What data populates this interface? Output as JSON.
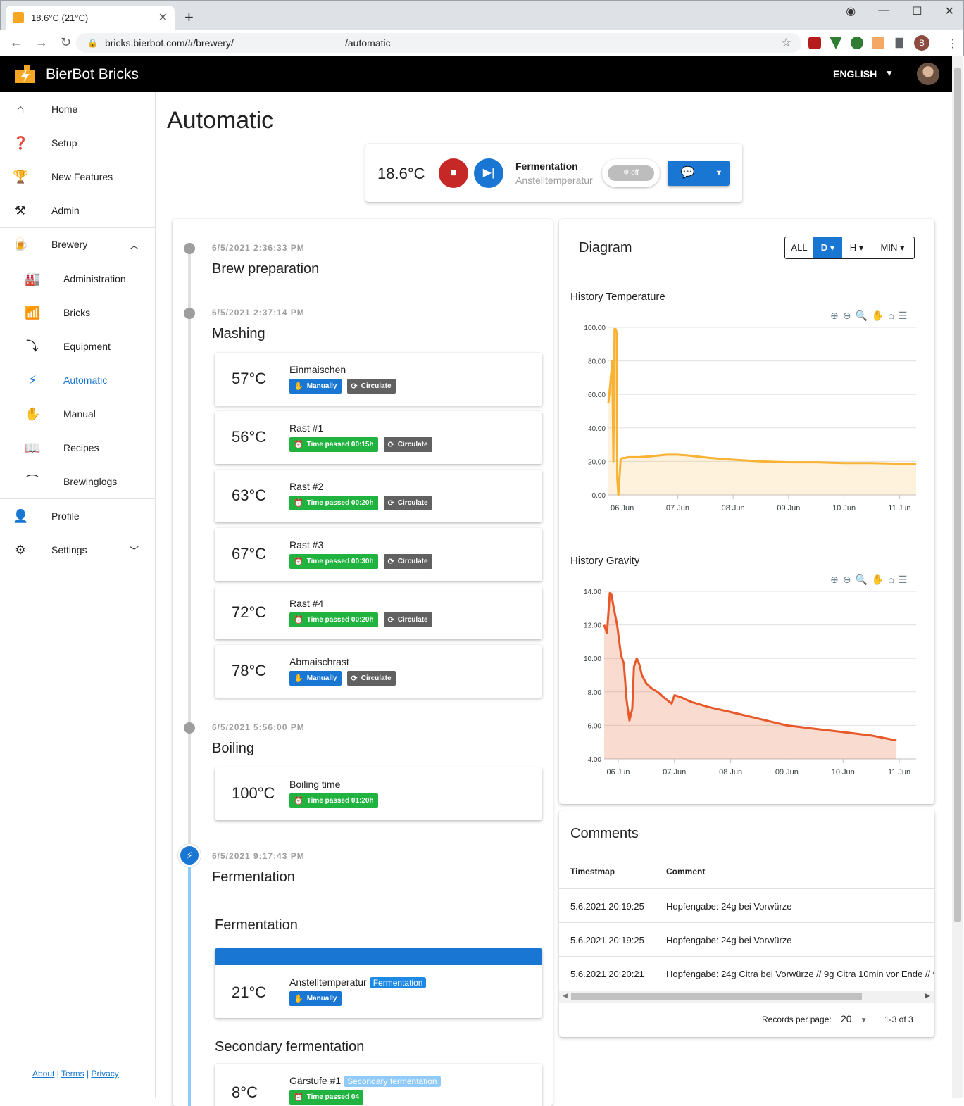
{
  "browser": {
    "tab_title": "18.6°C (21°C)",
    "url": "bricks.bierbot.com/#/brewery/",
    "url_path": "/automatic",
    "profile_initial": "B"
  },
  "app": {
    "brand": "BierBot Bricks",
    "language": "ENGLISH"
  },
  "sidebar": {
    "items": [
      {
        "label": "Home",
        "icon": "home-icon"
      },
      {
        "label": "Setup",
        "icon": "help-icon"
      },
      {
        "label": "New Features",
        "icon": "trophy-icon"
      },
      {
        "label": "Admin",
        "icon": "tools-icon"
      },
      {
        "label": "Brewery",
        "icon": "kettle-icon"
      },
      {
        "label": "Administration",
        "icon": "factory-icon"
      },
      {
        "label": "Bricks",
        "icon": "wifi-gear-icon"
      },
      {
        "label": "Equipment",
        "icon": "pipe-icon"
      },
      {
        "label": "Automatic",
        "icon": "bolt-icon"
      },
      {
        "label": "Manual",
        "icon": "hand-icon"
      },
      {
        "label": "Recipes",
        "icon": "book-icon"
      },
      {
        "label": "Brewinglogs",
        "icon": "curve-icon"
      },
      {
        "label": "Profile",
        "icon": "person-icon"
      },
      {
        "label": "Settings",
        "icon": "gear-icon"
      }
    ],
    "footer": {
      "about": "About",
      "terms": "Terms",
      "privacy": "Privacy",
      "sep": "|"
    }
  },
  "page": {
    "title": "Automatic"
  },
  "status": {
    "current_temp": "18.6°C",
    "phase_title": "Fermentation",
    "phase_step": "Anstelltemperatur",
    "toggle_label": "off"
  },
  "timeline": {
    "phases": [
      {
        "time": "6/5/2021 2:36:33 PM",
        "title": "Brew preparation"
      },
      {
        "time": "6/5/2021 2:37:14 PM",
        "title": "Mashing"
      },
      {
        "time": "6/5/2021 5:56:00 PM",
        "title": "Boiling"
      },
      {
        "time": "6/5/2021 9:17:43 PM",
        "title": "Fermentation"
      }
    ],
    "mash_steps": [
      {
        "temp": "57°C",
        "name": "Einmaischen",
        "b1": "Manually",
        "b2": "Circulate"
      },
      {
        "temp": "56°C",
        "name": "Rast #1",
        "b1": "Time passed 00:15h",
        "b2": "Circulate"
      },
      {
        "temp": "63°C",
        "name": "Rast #2",
        "b1": "Time passed 00:20h",
        "b2": "Circulate"
      },
      {
        "temp": "67°C",
        "name": "Rast #3",
        "b1": "Time passed 00:30h",
        "b2": "Circulate"
      },
      {
        "temp": "72°C",
        "name": "Rast #4",
        "b1": "Time passed 00:20h",
        "b2": "Circulate"
      },
      {
        "temp": "78°C",
        "name": "Abmaischrast",
        "b1": "Manually",
        "b2": "Circulate"
      }
    ],
    "boil_step": {
      "temp": "100°C",
      "name": "Boiling time",
      "b1": "Time passed 01:20h"
    },
    "ferm_heading": "Fermentation",
    "ferm_step": {
      "temp": "21°C",
      "name": "Anstelltemperatur",
      "chip": "Fermentation",
      "b1": "Manually"
    },
    "secondary_heading": "Secondary fermentation",
    "secondary_step": {
      "temp": "8°C",
      "name": "Gärstufe #1",
      "chip": "Secondary fermentation",
      "b1": "Time passed 04"
    }
  },
  "diagram": {
    "title": "Diagram",
    "ranges": [
      "ALL",
      "D",
      "H",
      "MIN"
    ],
    "selected_range": "D",
    "colors": {
      "temperature": "#f9b233",
      "gravity": "#e8592a"
    }
  },
  "chart_data": [
    {
      "type": "area",
      "title": "History Temperature",
      "xlabel": "",
      "ylabel": "",
      "x_ticks": [
        "06 Jun",
        "07 Jun",
        "08 Jun",
        "09 Jun",
        "10 Jun",
        "11 Jun"
      ],
      "y_ticks": [
        "0.00",
        "20.00",
        "40.00",
        "60.00",
        "80.00",
        "100.00"
      ],
      "ylim": [
        0,
        100
      ],
      "xlim": [
        5.75,
        11.3
      ],
      "series": [
        {
          "x": [
            5.75,
            5.78,
            5.82,
            5.84,
            5.86,
            5.88,
            5.9,
            5.91,
            5.93,
            5.95,
            5.97,
            6.0,
            6.05,
            6.1,
            6.3,
            6.5,
            6.8,
            7.0,
            7.2,
            7.6,
            8.0,
            8.5,
            9.0,
            9.5,
            10.0,
            10.5,
            11.0,
            11.3
          ],
          "y": [
            55,
            65,
            80,
            20,
            99,
            99,
            97,
            10,
            0,
            10,
            21,
            22,
            22,
            22.5,
            22.5,
            23,
            24,
            24,
            23.5,
            22,
            21,
            20,
            19.5,
            19.5,
            19,
            19,
            18.6,
            18.6
          ]
        }
      ]
    },
    {
      "type": "area",
      "title": "History Gravity",
      "xlabel": "",
      "ylabel": "",
      "x_ticks": [
        "06 Jun",
        "07 Jun",
        "08 Jun",
        "09 Jun",
        "10 Jun",
        "11 Jun"
      ],
      "y_ticks": [
        "4.00",
        "6.00",
        "8.00",
        "10.00",
        "12.00",
        "14.00"
      ],
      "ylim": [
        4,
        14
      ],
      "xlim": [
        5.75,
        11.3
      ],
      "series": [
        {
          "x": [
            5.75,
            5.8,
            5.85,
            5.88,
            5.92,
            5.98,
            6.05,
            6.1,
            6.15,
            6.2,
            6.25,
            6.28,
            6.33,
            6.38,
            6.42,
            6.5,
            6.6,
            6.7,
            6.8,
            6.95,
            7.0,
            7.1,
            7.3,
            7.6,
            8.0,
            8.5,
            9.0,
            9.5,
            10.0,
            10.5,
            10.8,
            10.95
          ],
          "y": [
            12.0,
            11.5,
            13.9,
            13.8,
            13.0,
            12.0,
            10.2,
            9.7,
            7.5,
            6.3,
            7.0,
            9.5,
            10.0,
            9.6,
            9.0,
            8.5,
            8.2,
            8.0,
            7.7,
            7.3,
            7.8,
            7.7,
            7.4,
            7.1,
            6.8,
            6.4,
            6.0,
            5.8,
            5.6,
            5.4,
            5.2,
            5.1
          ]
        }
      ]
    }
  ],
  "comments": {
    "title": "Comments",
    "headers": [
      "Timestmap",
      "Comment"
    ],
    "rows": [
      {
        "ts": "5.6.2021 20:19:25",
        "text": "Hopfengabe: 24g bei Vorwürze"
      },
      {
        "ts": "5.6.2021 20:19:25",
        "text": "Hopfengabe: 24g bei Vorwürze"
      },
      {
        "ts": "5.6.2021 20:20:21",
        "text": "Hopfengabe: 24g Citra bei Vorwürze // 9g Citra 10min vor Ende // 9"
      }
    ],
    "records_label": "Records per page:",
    "records_value": "20",
    "range_text": "1-3 of 3"
  }
}
